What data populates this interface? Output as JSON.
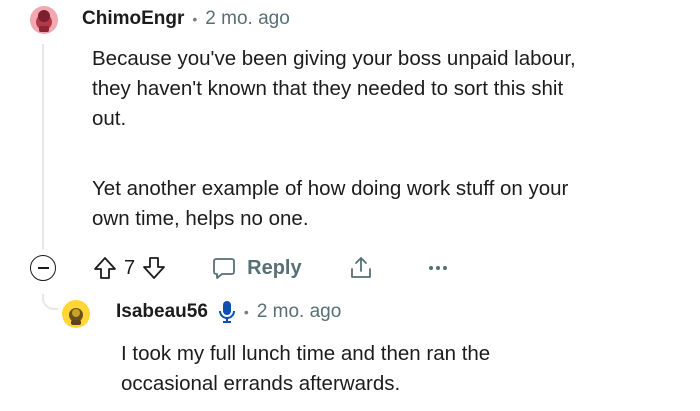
{
  "comment": {
    "author": "ChimoEngr",
    "separator": "•",
    "time": "2 mo. ago",
    "paragraph1": "Because you've been giving your boss unpaid labour,\nthey haven't known that they needed to sort this shit\nout.",
    "paragraph2": "Yet another example of how doing work stuff on your\nown time, helps no one.",
    "vote_count": "7",
    "reply_label": "Reply",
    "more_label": "•••",
    "icons": [
      "collapse-icon",
      "upvote-icon",
      "downvote-icon",
      "reply-icon",
      "share-icon",
      "more-icon"
    ]
  },
  "reply": {
    "author": "Isabeau56",
    "separator": "•",
    "time": "2 mo. ago",
    "text": "I took my full lunch time and then ran the\noccasional errands afterwards.",
    "icons": [
      "microphone-icon"
    ]
  },
  "colors": {
    "text": "#1c1c1c",
    "muted": "#576f76",
    "thread_line": "#e5e7e9",
    "avatar1_bg": "#f2a7b1",
    "avatar2_bg": "#ffd635",
    "mic_blue": "#0e4fb3"
  }
}
